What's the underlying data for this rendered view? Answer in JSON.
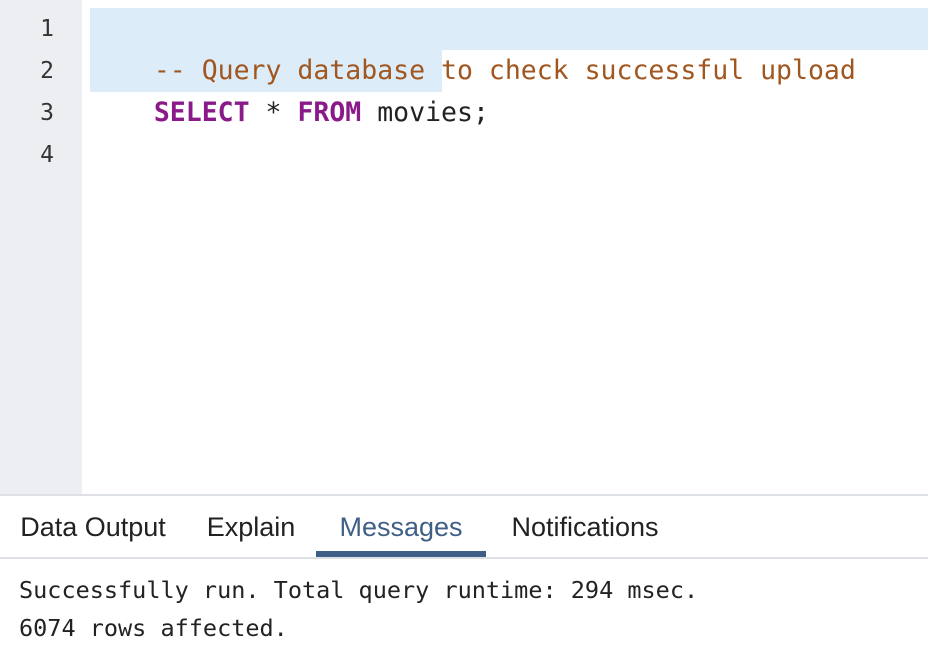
{
  "editor": {
    "line_numbers": [
      "1",
      "2",
      "3",
      "4"
    ],
    "lines": [
      {
        "comment": "-- Query database to check successful upload"
      },
      {
        "keyword1": "SELECT",
        "op": " * ",
        "keyword2": "FROM",
        "rest": " movies;"
      }
    ]
  },
  "tabs": [
    {
      "label": "Data Output",
      "active": false
    },
    {
      "label": "Explain",
      "active": false
    },
    {
      "label": "Messages",
      "active": true
    },
    {
      "label": "Notifications",
      "active": false
    }
  ],
  "messages": [
    "Successfully run. Total query runtime: 294 msec.",
    "6074 rows affected."
  ],
  "colors": {
    "accent": "#3e5f86",
    "comment": "#a0561e",
    "keyword": "#8a1a8a",
    "selection": "#dcecf8",
    "gutter": "#eceef2"
  }
}
